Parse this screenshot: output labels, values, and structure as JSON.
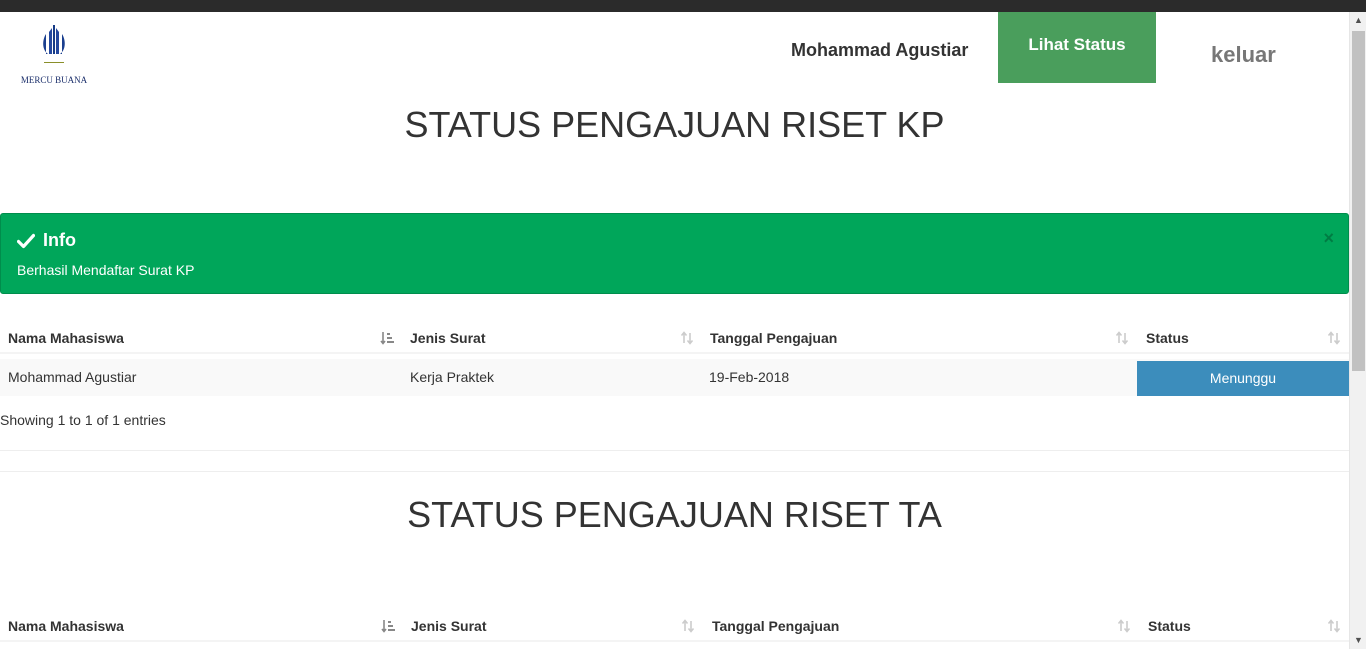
{
  "brand": {
    "logo_text": "MERCU BUANA"
  },
  "nav": {
    "user_name": "Mohammad Agustiar",
    "status_label": "Lihat Status",
    "logout_label": "keluar"
  },
  "kp_section": {
    "title": "STATUS PENGAJUAN RISET KP",
    "alert": {
      "heading": "Info",
      "message": "Berhasil Mendaftar Surat KP",
      "close": "×"
    },
    "columns": [
      "Nama Mahasiswa",
      "Jenis Surat",
      "Tanggal Pengajuan",
      "Status"
    ],
    "rows": [
      {
        "nama": "Mohammad Agustiar",
        "jenis": "Kerja Praktek",
        "tanggal": "19-Feb-2018",
        "status": "Menunggu"
      }
    ],
    "info": "Showing 1 to 1 of 1 entries"
  },
  "ta_section": {
    "title": "STATUS PENGAJUAN RISET TA",
    "columns": [
      "Nama Mahasiswa",
      "Jenis Surat",
      "Tanggal Pengajuan",
      "Status"
    ]
  },
  "colors": {
    "nav_active": "#4a9e5c",
    "alert_success": "#00a65a",
    "status_badge": "#3c8dbc"
  }
}
